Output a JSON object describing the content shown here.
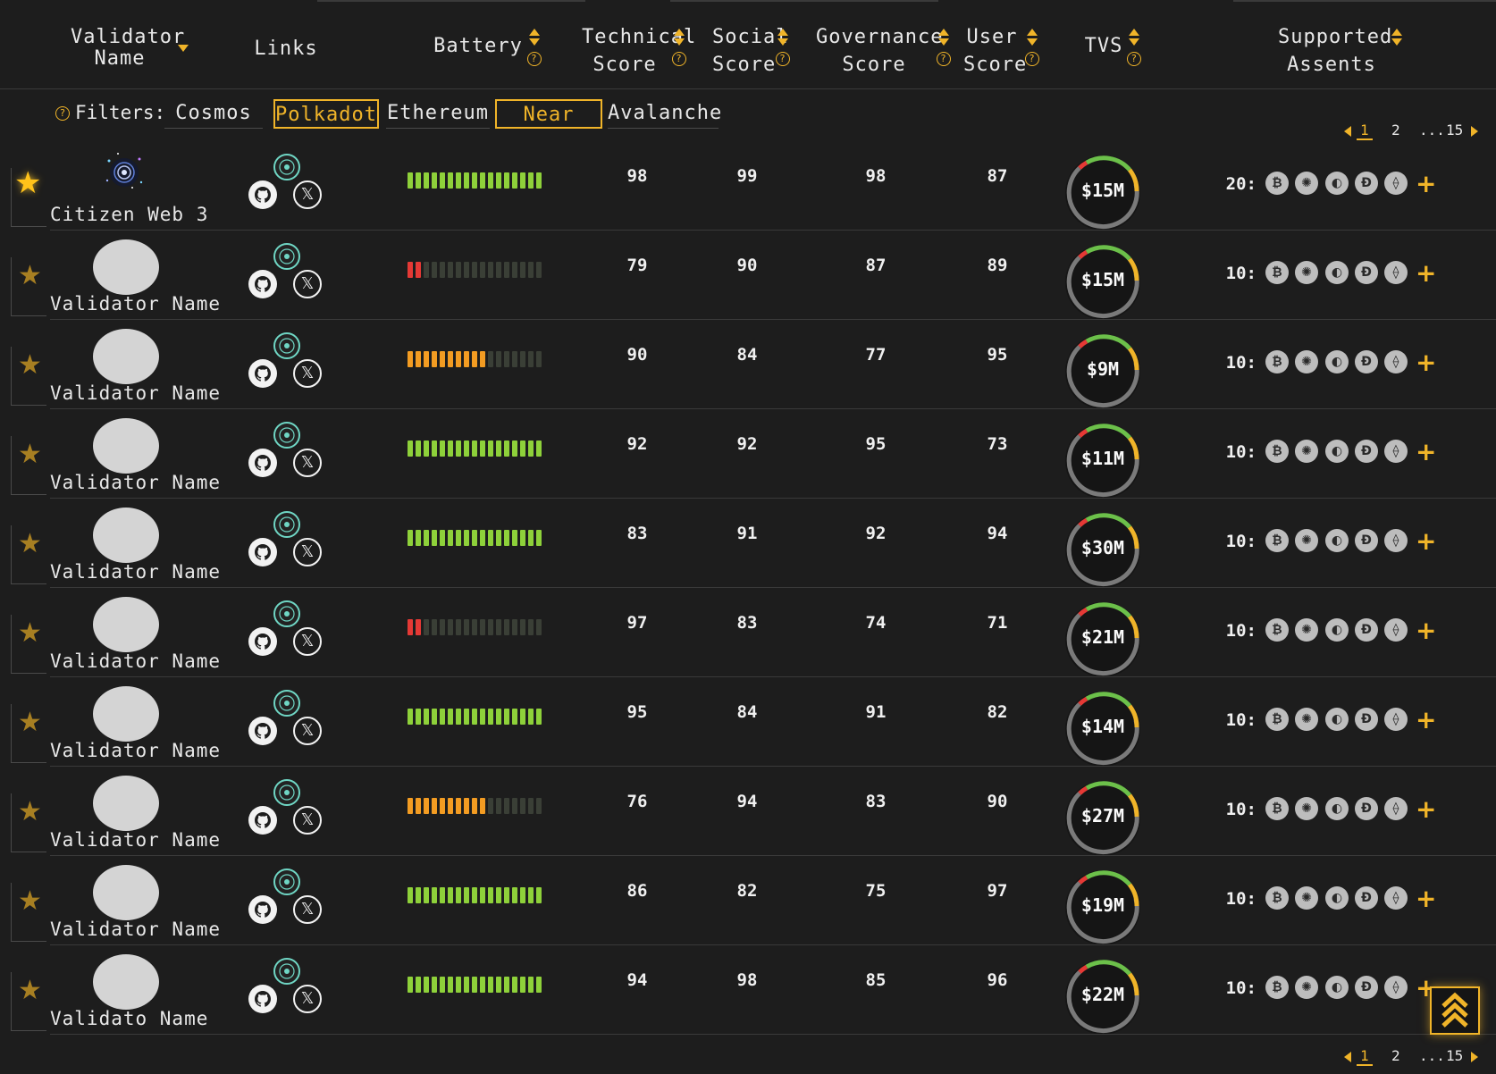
{
  "header": {
    "validator_name": "Validator Name",
    "links": "Links",
    "battery": "Battery",
    "technical_score": "Technical Score",
    "social_score": "Social Score",
    "governance_score": "Governance Score",
    "user_score": "User Score",
    "tvs": "TVS",
    "supported_assets": "Supported Assents",
    "help_glyph": "?"
  },
  "filters": {
    "label": "Filters:",
    "help_glyph": "?",
    "options": [
      {
        "label": "Cosmos",
        "active": false
      },
      {
        "label": "Polkadot",
        "active": true
      },
      {
        "label": "Ethereum",
        "active": false
      },
      {
        "label": "Near",
        "active": true
      },
      {
        "label": "Avalanche",
        "active": false
      }
    ]
  },
  "pagination": {
    "pages": [
      "1",
      "2",
      "...",
      "15"
    ],
    "current": "1"
  },
  "colors": {
    "accent": "#f0b429",
    "battery_green": "#8ed13a",
    "battery_orange": "#f39c22",
    "battery_red": "#e53935",
    "battery_off": "#3a3f36",
    "gauge_green": "#6cc04a",
    "gauge_yellow": "#f0b429",
    "gauge_red": "#e53935",
    "gauge_track": "#7a7a7a"
  },
  "icons": {
    "star": "★",
    "x": "𝕏"
  },
  "coins": [
    "₿",
    "✺",
    "◐",
    "Đ",
    "⟠"
  ],
  "plus_glyph": "+",
  "rows": [
    {
      "name": "Citizen Web 3",
      "favorite": true,
      "has_logo": true,
      "battery_level": 1.0,
      "battery_color": "green",
      "technical": "98",
      "social": "99",
      "governance": "98",
      "user": "87",
      "tvs": "$15M",
      "assets_count": "20:"
    },
    {
      "name": "Validator Name",
      "favorite": false,
      "has_logo": false,
      "battery_level": 0.13,
      "battery_color": "red",
      "technical": "79",
      "social": "90",
      "governance": "87",
      "user": "89",
      "tvs": "$15M",
      "assets_count": "10:"
    },
    {
      "name": "Validator Name",
      "favorite": false,
      "has_logo": false,
      "battery_level": 0.6,
      "battery_color": "orange",
      "technical": "90",
      "social": "84",
      "governance": "77",
      "user": "95",
      "tvs": "$9M",
      "assets_count": "10:"
    },
    {
      "name": "Validator Name",
      "favorite": false,
      "has_logo": false,
      "battery_level": 1.0,
      "battery_color": "green",
      "technical": "92",
      "social": "92",
      "governance": "95",
      "user": "73",
      "tvs": "$11M",
      "assets_count": "10:"
    },
    {
      "name": "Validator Name",
      "favorite": false,
      "has_logo": false,
      "battery_level": 1.0,
      "battery_color": "green",
      "technical": "83",
      "social": "91",
      "governance": "92",
      "user": "94",
      "tvs": "$30M",
      "assets_count": "10:"
    },
    {
      "name": "Validator Name",
      "favorite": false,
      "has_logo": false,
      "battery_level": 0.13,
      "battery_color": "red",
      "technical": "97",
      "social": "83",
      "governance": "74",
      "user": "71",
      "tvs": "$21M",
      "assets_count": "10:"
    },
    {
      "name": "Validator Name",
      "favorite": false,
      "has_logo": false,
      "battery_level": 1.0,
      "battery_color": "green",
      "technical": "95",
      "social": "84",
      "governance": "91",
      "user": "82",
      "tvs": "$14M",
      "assets_count": "10:"
    },
    {
      "name": "Validator Name",
      "favorite": false,
      "has_logo": false,
      "battery_level": 0.6,
      "battery_color": "orange",
      "technical": "76",
      "social": "94",
      "governance": "83",
      "user": "90",
      "tvs": "$27M",
      "assets_count": "10:"
    },
    {
      "name": "Validator Name",
      "favorite": false,
      "has_logo": false,
      "battery_level": 1.0,
      "battery_color": "green",
      "technical": "86",
      "social": "82",
      "governance": "75",
      "user": "97",
      "tvs": "$19M",
      "assets_count": "10:"
    },
    {
      "name": "Validato Name",
      "favorite": false,
      "has_logo": false,
      "battery_level": 1.0,
      "battery_color": "green",
      "technical": "94",
      "social": "98",
      "governance": "85",
      "user": "96",
      "tvs": "$22M",
      "assets_count": "10:"
    }
  ]
}
